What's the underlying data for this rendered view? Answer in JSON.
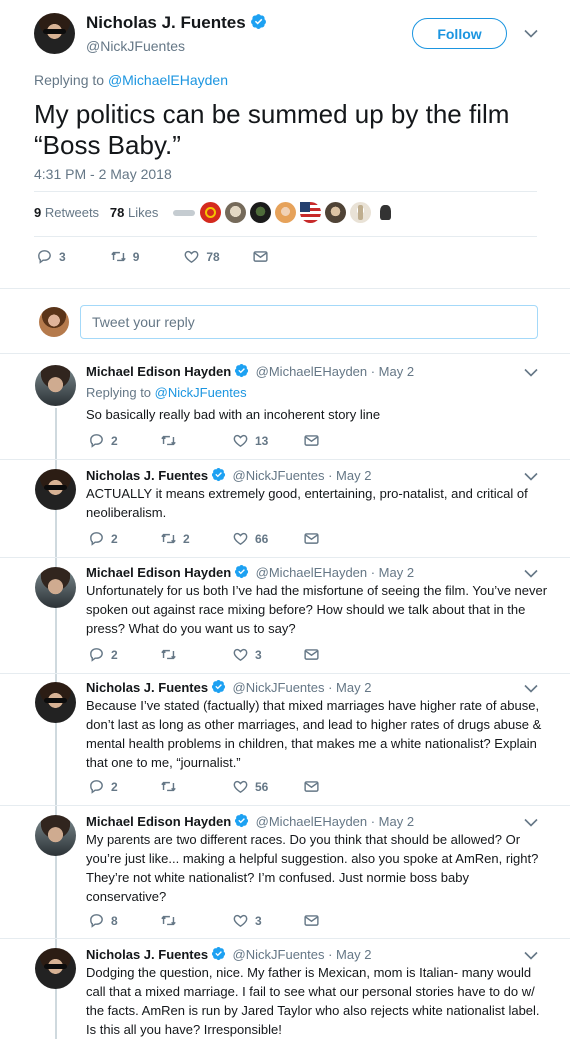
{
  "main": {
    "author_name": "Nicholas J. Fuentes",
    "author_handle": "@NickJFuentes",
    "follow_label": "Follow",
    "replying_prefix": "Replying to",
    "replying_to": "@MichaelEHayden",
    "text_line1": "My politics can be summed up by the film",
    "text_line2": "“Boss Baby.”",
    "timestamp": "4:31 PM - 2 May 2018",
    "retweets_count": "9",
    "retweets_label": "Retweets",
    "likes_count": "78",
    "likes_label": "Likes",
    "reply_count": "3",
    "retweet_count": "9",
    "like_count": "78"
  },
  "compose": {
    "placeholder": "Tweet your reply"
  },
  "replies": [
    {
      "name": "Michael Edison Hayden",
      "handle": "@MichaelEHayden · May 2",
      "replying_prefix": "Replying to",
      "replying_to": "@NickJFuentes",
      "lines": [
        "So basically really bad with an incoherent story line"
      ],
      "reply": "2",
      "retweet": "",
      "like": "13"
    },
    {
      "name": "Nicholas J. Fuentes",
      "handle": "@NickJFuentes · May 2",
      "lines": [
        "ACTUALLY it means extremely good, entertaining, pro-natalist, and critical of",
        "neoliberalism."
      ],
      "reply": "2",
      "retweet": "2",
      "like": "66"
    },
    {
      "name": "Michael Edison Hayden",
      "handle": "@MichaelEHayden · May 2",
      "lines": [
        "Unfortunately for us both I’ve had the misfortune of seeing the film. You’ve never",
        "spoken out against race mixing before? How should we talk about that in the",
        "press? What do you want us to say?"
      ],
      "reply": "2",
      "retweet": "",
      "like": "3"
    },
    {
      "name": "Nicholas J. Fuentes",
      "handle": "@NickJFuentes · May 2",
      "lines": [
        "Because I’ve stated (factually) that mixed marriages have higher rate of abuse,",
        "don’t last as long as other marriages, and lead to higher rates of drugs abuse &",
        "mental health problems in children, that makes me a white nationalist? Explain",
        "that one to me, “journalist.”"
      ],
      "reply": "2",
      "retweet": "",
      "like": "56"
    },
    {
      "name": "Michael Edison Hayden",
      "handle": "@MichaelEHayden · May 2",
      "lines": [
        "My parents are two different races. Do you think that should be allowed? Or",
        "you’re just like... making a helpful suggestion. also you spoke at AmRen, right?",
        "They’re not white nationalist? I’m confused. Just normie boss baby",
        "conservative?"
      ],
      "reply": "8",
      "retweet": "",
      "like": "3"
    },
    {
      "name": "Nicholas J. Fuentes",
      "handle": "@NickJFuentes · May 2",
      "lines": [
        "Dodging the question, nice. My father is Mexican, mom is Italian- many would",
        "call that a mixed marriage. I fail to see what our personal stories have to do w/",
        "the facts. AmRen is run by Jared Taylor who also rejects white nationalist label.",
        "Is this all you have? Irresponsible!"
      ]
    }
  ],
  "colors": {
    "accent": "#1b95e0",
    "verified": "#1da1f2",
    "muted": "#657786",
    "border": "#e6ecf0"
  }
}
